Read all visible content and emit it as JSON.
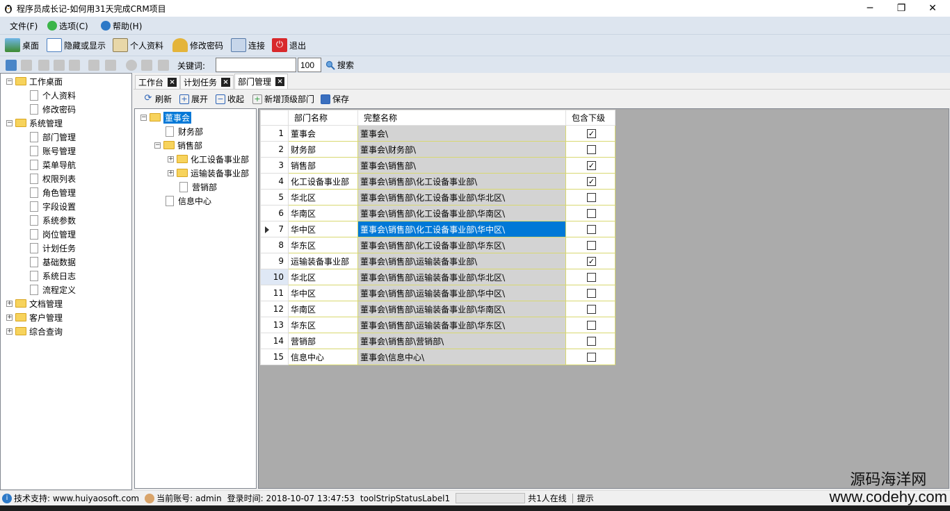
{
  "window": {
    "title": "程序员成长记-如何用31天完成CRM项目",
    "minimize": "─",
    "maximize": "❐",
    "close": "✕"
  },
  "menu": [
    "文件(F)",
    "选项(C)",
    "帮助(H)"
  ],
  "toolbar": [
    "桌面",
    "隐藏或显示",
    "个人资料",
    "修改密码",
    "连接",
    "退出"
  ],
  "search": {
    "keyword_label": "关键词:",
    "keyword_value": "",
    "page_size": "100",
    "search_label": "搜索"
  },
  "nav": {
    "groups": [
      {
        "label": "工作桌面",
        "expanded": true,
        "items": [
          "个人资料",
          "修改密码"
        ]
      },
      {
        "label": "系统管理",
        "expanded": true,
        "items": [
          "部门管理",
          "账号管理",
          "菜单导航",
          "权限列表",
          "角色管理",
          "字段设置",
          "系统参数",
          "岗位管理",
          "计划任务",
          "基础数据",
          "系统日志",
          "流程定义"
        ]
      },
      {
        "label": "文档管理",
        "expanded": false,
        "items": []
      },
      {
        "label": "客户管理",
        "expanded": false,
        "items": []
      },
      {
        "label": "综合查询",
        "expanded": false,
        "items": []
      }
    ]
  },
  "tabs": [
    "工作台",
    "计划任务",
    "部门管理"
  ],
  "active_tab": "部门管理",
  "subtoolbar": [
    "刷新",
    "展开",
    "收起",
    "新增顶级部门",
    "保存"
  ],
  "dept_tree": {
    "root": "董事会",
    "nodes": [
      "财务部",
      "销售部",
      "化工设备事业部",
      "运输装备事业部",
      "营销部",
      "信息中心"
    ]
  },
  "grid": {
    "headers": [
      "部门名称",
      "完整名称",
      "包含下级"
    ],
    "rows": [
      {
        "no": "1",
        "name": "董事会",
        "full": "董事会\\",
        "checked": true
      },
      {
        "no": "2",
        "name": "财务部",
        "full": "董事会\\财务部\\",
        "checked": false
      },
      {
        "no": "3",
        "name": "销售部",
        "full": "董事会\\销售部\\",
        "checked": true
      },
      {
        "no": "4",
        "name": "化工设备事业部",
        "full": "董事会\\销售部\\化工设备事业部\\",
        "checked": true
      },
      {
        "no": "5",
        "name": "华北区",
        "full": "董事会\\销售部\\化工设备事业部\\华北区\\",
        "checked": false
      },
      {
        "no": "6",
        "name": "华南区",
        "full": "董事会\\销售部\\化工设备事业部\\华南区\\",
        "checked": false
      },
      {
        "no": "7",
        "name": "华中区",
        "full": "董事会\\销售部\\化工设备事业部\\华中区\\",
        "checked": false
      },
      {
        "no": "8",
        "name": "华东区",
        "full": "董事会\\销售部\\化工设备事业部\\华东区\\",
        "checked": false
      },
      {
        "no": "9",
        "name": "运输装备事业部",
        "full": "董事会\\销售部\\运输装备事业部\\",
        "checked": true
      },
      {
        "no": "10",
        "name": "华北区",
        "full": "董事会\\销售部\\运输装备事业部\\华北区\\",
        "checked": false
      },
      {
        "no": "11",
        "name": "华中区",
        "full": "董事会\\销售部\\运输装备事业部\\华中区\\",
        "checked": false
      },
      {
        "no": "12",
        "name": "华南区",
        "full": "董事会\\销售部\\运输装备事业部\\华南区\\",
        "checked": false
      },
      {
        "no": "13",
        "name": "华东区",
        "full": "董事会\\销售部\\运输装备事业部\\华东区\\",
        "checked": false
      },
      {
        "no": "14",
        "name": "营销部",
        "full": "董事会\\销售部\\营销部\\",
        "checked": false
      },
      {
        "no": "15",
        "name": "信息中心",
        "full": "董事会\\信息中心\\",
        "checked": false
      }
    ],
    "selected_row": "7",
    "current_row": "10"
  },
  "status": {
    "support": "技术支持: www.huiyaosoft.com",
    "account": "当前账号: admin",
    "login_time": "登录时间: 2018-10-07 13:47:53",
    "label1": "toolStripStatusLabel1",
    "online": "共1人在线",
    "hint": "提示"
  },
  "watermark": {
    "line1": "源码海洋网",
    "line2": "www.codehy.com"
  },
  "colors": {
    "selection": "#0078d7",
    "bar": "#dde5ef",
    "folder": "#f7d35c"
  }
}
